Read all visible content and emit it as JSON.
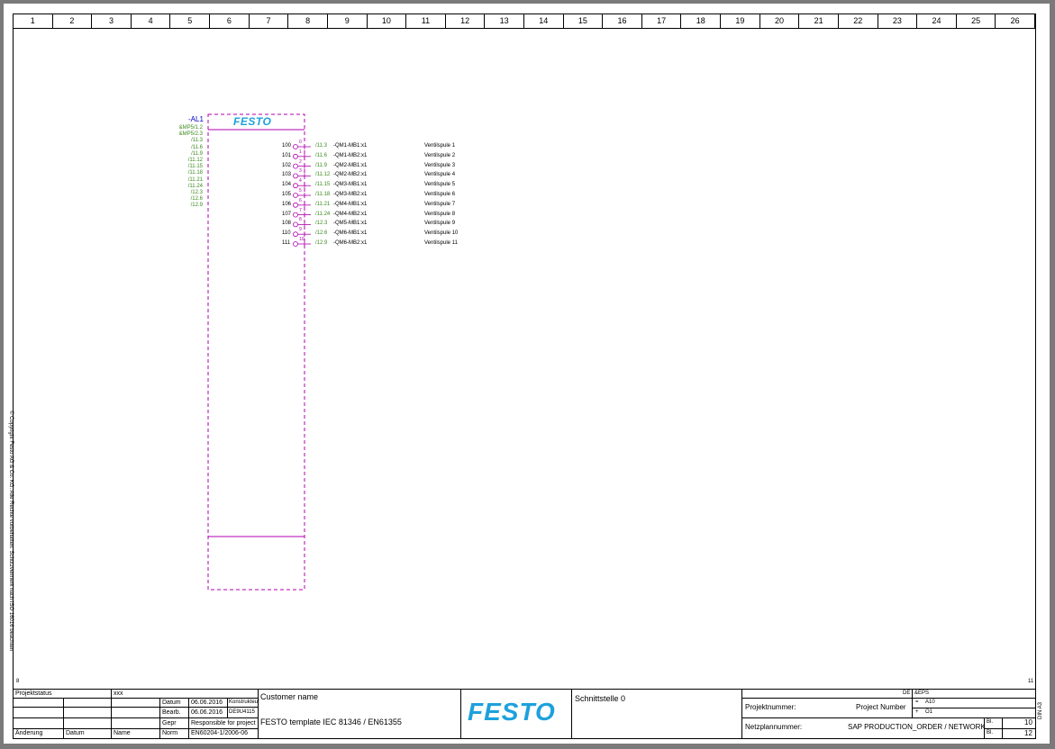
{
  "columns": [
    "1",
    "2",
    "3",
    "4",
    "5",
    "6",
    "7",
    "8",
    "9",
    "10",
    "11",
    "12",
    "13",
    "14",
    "15",
    "16",
    "17",
    "18",
    "19",
    "20",
    "21",
    "22",
    "23",
    "24",
    "25",
    "26"
  ],
  "device": {
    "tag": "-AL1",
    "logo": "FESTO",
    "refs_left": [
      "&MP5/1.2",
      "&MP5/2.3",
      "/11.3",
      "/11.6",
      "/11.9",
      "/11.12",
      "/11.15",
      "/11.18",
      "/11.21",
      "/11.24",
      "/12.3",
      "/12.6",
      "/12.9"
    ]
  },
  "outputs": [
    {
      "num": "100",
      "pin": "0",
      "ref": "/11.3",
      "target": "-QM1-MB1:x1",
      "desc": "Ventilspule 1"
    },
    {
      "num": "101",
      "pin": "1",
      "ref": "/11.6",
      "target": "-QM1-MB2:x1",
      "desc": "Ventilspule 2"
    },
    {
      "num": "102",
      "pin": "2",
      "ref": "/11.9",
      "target": "-QM2-MB1:x1",
      "desc": "Ventilspule 3"
    },
    {
      "num": "103",
      "pin": "3",
      "ref": "/11.12",
      "target": "-QM2-MB2:x1",
      "desc": "Ventilspule 4"
    },
    {
      "num": "104",
      "pin": "4",
      "ref": "/11.15",
      "target": "-QM3-MB1:x1",
      "desc": "Ventilspule 5"
    },
    {
      "num": "105",
      "pin": "5",
      "ref": "/11.18",
      "target": "-QM3-MB2:x1",
      "desc": "Ventilspule 6"
    },
    {
      "num": "106",
      "pin": "6",
      "ref": "/11.21",
      "target": "-QM4-MB1:x1",
      "desc": "Ventilspule 7"
    },
    {
      "num": "107",
      "pin": "7",
      "ref": "/11.24",
      "target": "-QM4-MB2:x1",
      "desc": "Ventilspule 8"
    },
    {
      "num": "108",
      "pin": "8",
      "ref": "/12.3",
      "target": "-QM5-MB1:x1",
      "desc": "Ventilspule 9"
    },
    {
      "num": "110",
      "pin": "9",
      "ref": "/12.6",
      "target": "-QM6-MB1:x1",
      "desc": "Ventilspule 10"
    },
    {
      "num": "111",
      "pin": "10",
      "ref": "/12.9",
      "target": "-QM6-MB2:x1",
      "desc": "Ventilspule 11"
    }
  ],
  "copyright": "© Copyright Festo AG & Co. KG. Alle Rechte vorbehalten. Schutzvermerk nach ISO 16016 beachten",
  "sheet_prev": "8",
  "sheet_next": "11",
  "title_block": {
    "projektstatus_label": "Projektstatus",
    "projektstatus_value": "xxx",
    "datum_label": "Datum",
    "datum_value": "06.06.2016",
    "role1": "Konstrukteur",
    "bearb_label": "Bearb.",
    "bearb_value": "06.06.2016",
    "bearb_user": "DE9U4115",
    "gepr_label": "Gepr",
    "gepr_value": "Responsible for project",
    "norm_label": "Norm",
    "norm_value": "EN60204-1/2006-06",
    "aenderung_label": "Änderung",
    "datum2_label": "Datum",
    "name_label": "Name",
    "customer": "Customer name",
    "template": "FESTO template IEC 81346 / EN61355",
    "logo": "FESTO",
    "schnittstelle": "Schnittstelle 0",
    "lang": "DE",
    "doc_code": "&EPS",
    "eq1": "=",
    "eq1_val": "A10",
    "plus1": "+",
    "plus1_val": "O1",
    "projektnummer_label": "Projektnummer:",
    "projektnummer_value": "Project Number",
    "netzplan_label": "Netzplannummer:",
    "netzplan_value": "SAP PRODUCTION_ORDER / NETWORK",
    "bl1_label": "Bl.",
    "bl1_value": "10",
    "bl2_label": "Bl.",
    "bl2_value": "12",
    "side_code": "DIN A3"
  }
}
